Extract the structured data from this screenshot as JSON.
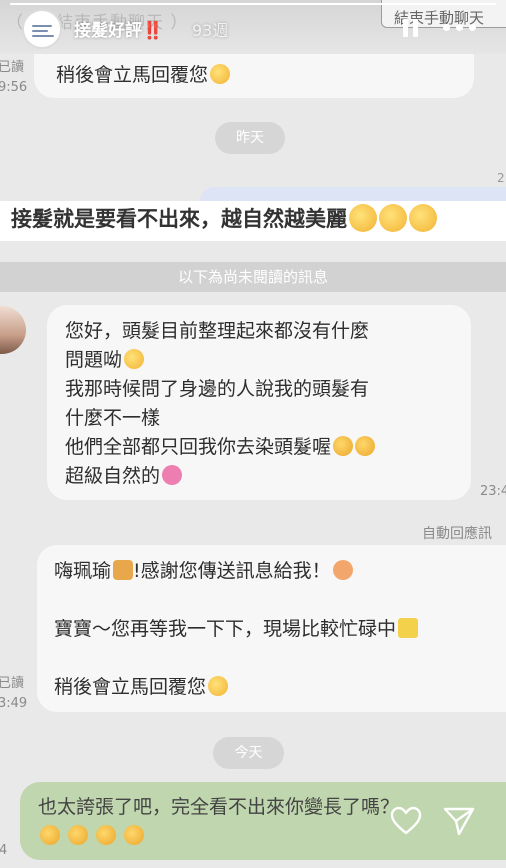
{
  "story": {
    "username": "接髮好評",
    "username_mark": "‼️",
    "time": "93週",
    "progress": 1.0,
    "pause_icon": "pause-icon",
    "more_icon": "more-icon"
  },
  "ghost_text": "（ ... 結束手動聊天 ）",
  "end_chat_label": "結束手動聊天",
  "chat": {
    "read_status_1": [
      "已讀",
      "9:56"
    ],
    "auto_reply_tail_1": "稍後會立馬回覆您",
    "date_yesterday": "昨天",
    "caption": "接髮就是要看不出來，越自然越美麗",
    "unread_divider": "以下為尚未閱讀的訊息",
    "customer_message": [
      "您好，頭髮目前整理起來都沒有什麼",
      "問題呦",
      "我那時候問了身邊的人說我的頭髮有",
      "什麼不一樣",
      "他們全部都只回我你去染頭髮喔",
      "超級自然的"
    ],
    "customer_time": "23:4",
    "auto_reply_label": "自動回應訊",
    "auto_reply": {
      "line1_a": "嗨珮瑜",
      "line1_b": "!感謝您傳送訊息給我！",
      "line2": "寶寶～您再等我一下下，現場比較忙碌中",
      "line3": "稍後會立馬回覆您"
    },
    "read_status_2": [
      "已讀",
      "3:49"
    ],
    "date_today": "今天",
    "my_reply": "也太誇張了吧，完全看不出來你變長了嗎？",
    "my_reply_time": "4"
  },
  "icons": {
    "heart": "heart-icon",
    "send": "send-icon"
  },
  "colors": {
    "my_bubble": "#bfd6ae",
    "chat_bg": "#e9e9e9",
    "bubble": "#f7f7f7",
    "pill": "#d6d6d6"
  }
}
